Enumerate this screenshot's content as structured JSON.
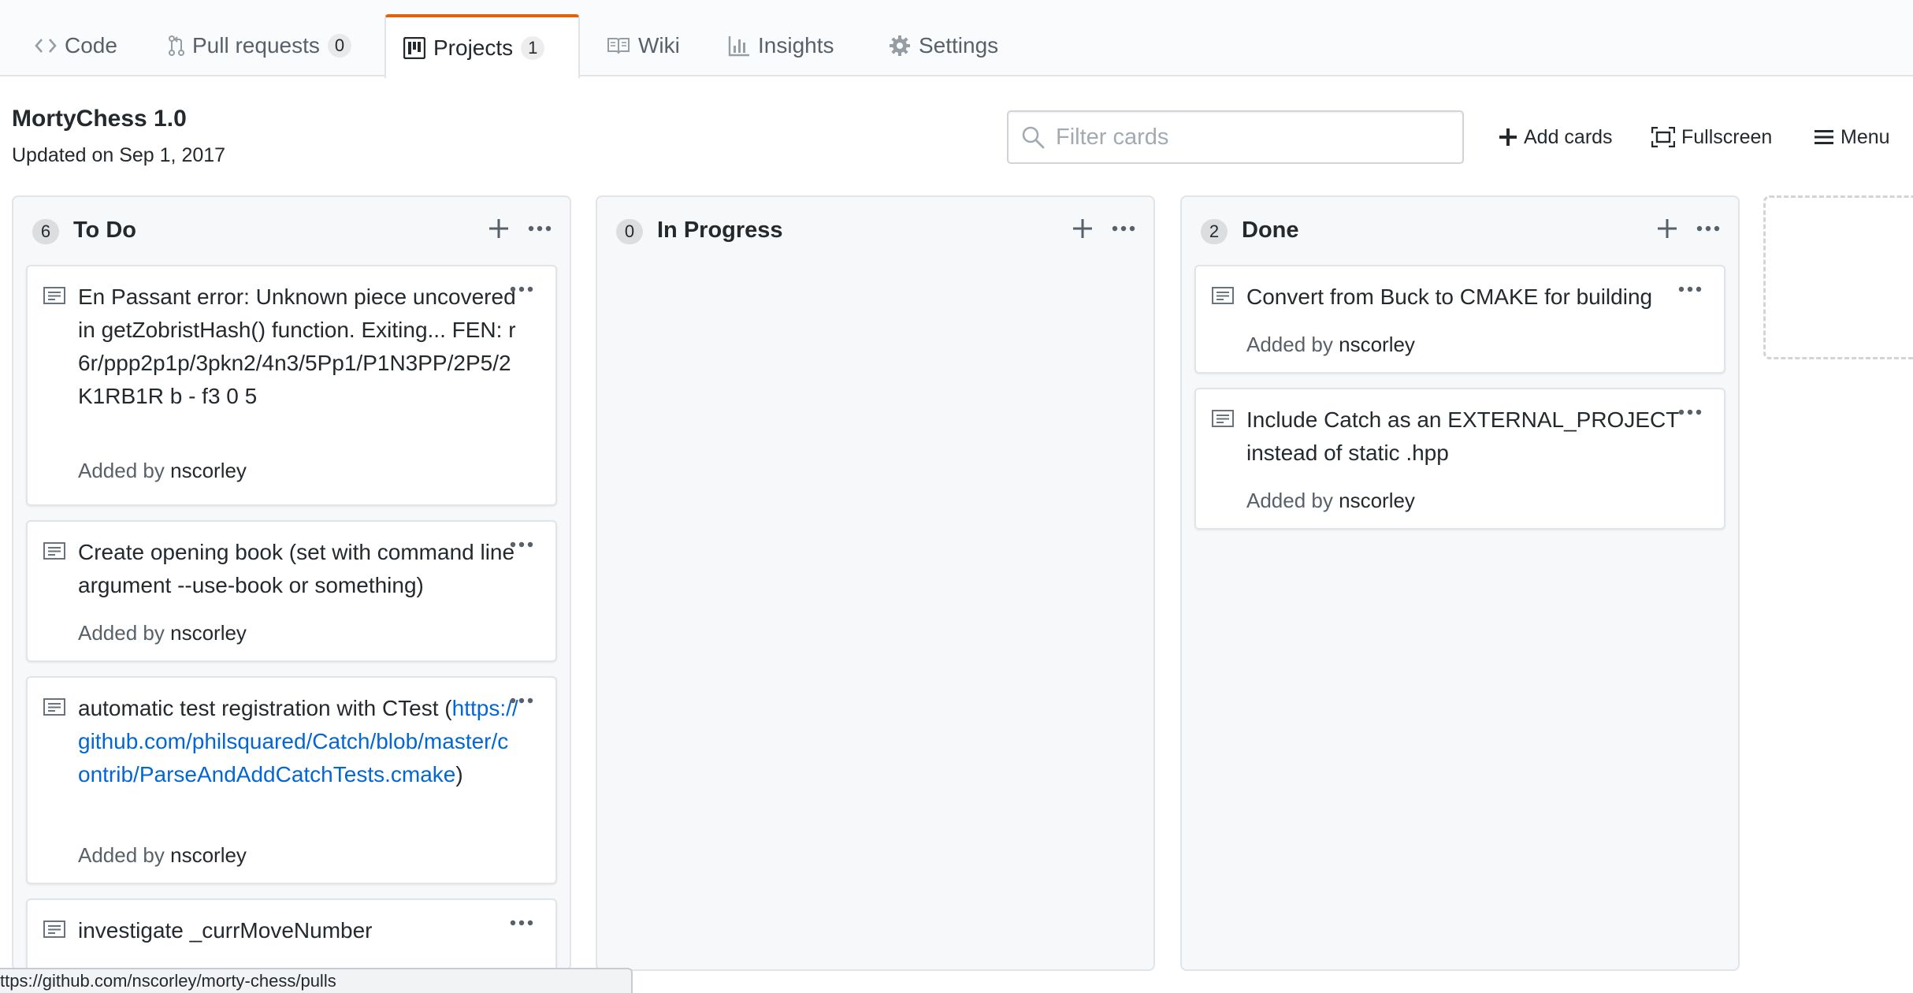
{
  "tabs": {
    "code": {
      "label": "Code",
      "icon": "code-icon"
    },
    "pulls": {
      "label": "Pull requests",
      "count": "0",
      "icon": "git-pull-request-icon"
    },
    "projects": {
      "label": "Projects",
      "count": "1",
      "icon": "project-icon",
      "selected": true
    },
    "wiki": {
      "label": "Wiki",
      "icon": "book-icon"
    },
    "insights": {
      "label": "Insights",
      "icon": "graph-icon"
    },
    "settings": {
      "label": "Settings",
      "icon": "gear-icon"
    }
  },
  "project": {
    "title": "MortyChess 1.0",
    "updated": "Updated on Sep 1, 2017"
  },
  "toolbar": {
    "filter_placeholder": "Filter cards",
    "add_cards": "Add cards",
    "fullscreen": "Fullscreen",
    "menu": "Menu"
  },
  "columns": [
    {
      "name": "To Do",
      "count": "6",
      "cards": [
        {
          "note": "En Passant error: Unknown piece uncovered in getZobristHash() function. Exiting... FEN: r6r/ppp2p1p/3pkn2/4n3/5Pp1/P1N3PP/2P5/2K1RB1R b - f3 0 5",
          "added_by_label": "Added by",
          "author": "nscorley"
        },
        {
          "note": "Create opening book (set with command line argument --use-book or something)",
          "added_by_label": "Added by",
          "author": "nscorley"
        },
        {
          "note_prefix": "automatic test registration with CTest (",
          "link": "https://github.com/philsquared/Catch/blob/master/contrib/ParseAndAddCatchTests.cmake",
          "note_suffix": ")",
          "added_by_label": "Added by",
          "author": "nscorley"
        },
        {
          "note": "investigate _currMoveNumber"
        }
      ]
    },
    {
      "name": "In Progress",
      "count": "0",
      "cards": []
    },
    {
      "name": "Done",
      "count": "2",
      "cards": [
        {
          "note": "Convert from Buck to CMAKE for building",
          "added_by_label": "Added by",
          "author": "nscorley"
        },
        {
          "note": "Include Catch as an EXTERNAL_PROJECT instead of static .hpp",
          "added_by_label": "Added by",
          "author": "nscorley"
        }
      ]
    }
  ],
  "status_bar": {
    "url": "ttps://github.com/nscorley/morty-chess/pulls"
  },
  "colors": {
    "accent_tab": "#e36209",
    "link": "#0366d6",
    "column_bg": "#f6f8fa"
  }
}
